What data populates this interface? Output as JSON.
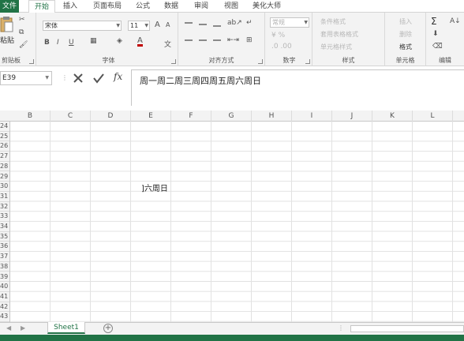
{
  "ribbon_tabs": [
    "文件",
    "开始",
    "插入",
    "页面布局",
    "公式",
    "数据",
    "审阅",
    "视图",
    "美化大师"
  ],
  "clipboard": {
    "paste_label": "粘贴",
    "group_label": "剪贴板"
  },
  "font": {
    "name": "宋体",
    "size": "11",
    "group_label": "字体",
    "bold": "B",
    "italic": "I",
    "underline": "U",
    "grow": "A",
    "shrink": "A",
    "font_color": "A",
    "phonetic": "文"
  },
  "alignment": {
    "group_label": "对齐方式"
  },
  "number": {
    "format": "常规",
    "group_label": "数字"
  },
  "styles": {
    "conditional": "条件格式",
    "table_format": "套用表格格式",
    "cell_styles": "单元格样式",
    "group_label": "样式"
  },
  "cells_group": {
    "insert": "插入",
    "delete": "删除",
    "format": "格式",
    "group_label": "单元格"
  },
  "editing": {
    "sum": "Σ",
    "group_label": "编辑"
  },
  "formula_bar": {
    "name_box": "E39",
    "fx": "fx",
    "content": "周一周二周三周四周五周六周日"
  },
  "columns": [
    "B",
    "C",
    "D",
    "E",
    "F",
    "G",
    "H",
    "I",
    "J",
    "K",
    "L"
  ],
  "rows": [
    "24",
    "25",
    "26",
    "27",
    "28",
    "29",
    "30",
    "31",
    "32",
    "33",
    "34",
    "35",
    "36",
    "37",
    "38",
    "39",
    "40",
    "41",
    "42",
    "43"
  ],
  "cell_overflow_text": "]六周日",
  "sheet": {
    "name": "Sheet1",
    "add": "+"
  },
  "colors": {
    "accent": "#217346"
  }
}
